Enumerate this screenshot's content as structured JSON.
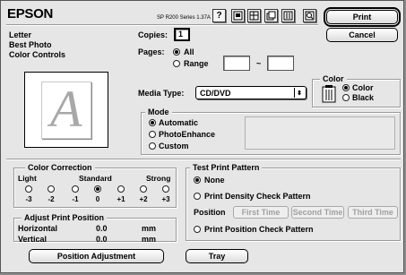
{
  "header": {
    "brand": "EPSON",
    "printer_model": "SP R200 Series 1.37A",
    "help_icon": "?",
    "print_label": "Print",
    "cancel_label": "Cancel"
  },
  "summary": {
    "paper": "Letter",
    "quality": "Best Photo",
    "color": "Color Controls"
  },
  "copies": {
    "label": "Copies:",
    "value": "1"
  },
  "pages": {
    "label": "Pages:",
    "all_label": "All",
    "range_label": "Range",
    "separator": "~",
    "from": "",
    "to": "",
    "selected": "All"
  },
  "media_type": {
    "label": "Media Type:",
    "value": "CD/DVD"
  },
  "color": {
    "title": "Color",
    "options": [
      "Color",
      "Black"
    ],
    "selected": "Color"
  },
  "mode": {
    "title": "Mode",
    "options": [
      "Automatic",
      "PhotoEnhance",
      "Custom"
    ],
    "selected": "Automatic"
  },
  "color_correction": {
    "title": "Color Correction",
    "scale_labels": {
      "light": "Light",
      "standard": "Standard",
      "strong": "Strong"
    },
    "ticks": [
      "-3",
      "-2",
      "-1",
      "0",
      "+1",
      "+2",
      "+3"
    ],
    "selected": "0"
  },
  "adjust_print_position": {
    "title": "Adjust Print Position",
    "horizontal_label": "Horizontal",
    "horizontal_value": "0.0",
    "horizontal_unit": "mm",
    "vertical_label": "Vertical",
    "vertical_value": "0.0",
    "vertical_unit": "mm",
    "button_label": "Position Adjustment"
  },
  "test_print_pattern": {
    "title": "Test Print Pattern",
    "none_label": "None",
    "density_label": "Print Density Check Pattern",
    "position_label": "Position",
    "first_time": "First Time",
    "second_time": "Second Time",
    "third_time": "Third Time",
    "position_check_label": "Print Position Check Pattern",
    "selected": "None"
  },
  "tray": {
    "label": "Tray"
  }
}
